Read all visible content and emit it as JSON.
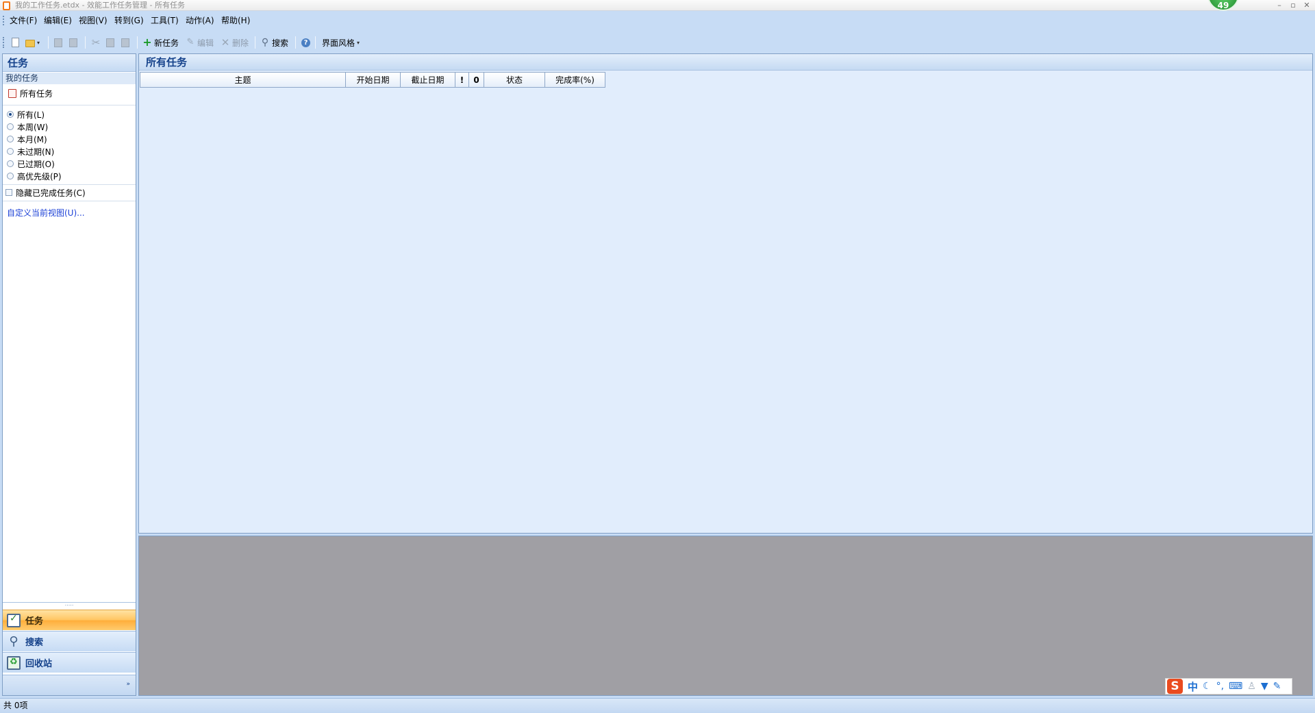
{
  "window": {
    "title": "我的工作任务.etdx - 效能工作任务管理 - 所有任务",
    "badge": "49",
    "controls": {
      "minimize": "–",
      "restore": "▫",
      "close": "✕"
    }
  },
  "menu": {
    "items": [
      "文件(F)",
      "编辑(E)",
      "视图(V)",
      "转到(G)",
      "工具(T)",
      "动作(A)",
      "帮助(H)"
    ]
  },
  "toolbar": {
    "new_task": "新任务",
    "edit": "编辑",
    "delete": "删除",
    "search": "搜索",
    "theme": "界面风格",
    "caret": "▾"
  },
  "left_pane": {
    "header": "任务",
    "group_label": "我的任务",
    "folder": "所有任务",
    "filters": [
      {
        "label": "所有(L)",
        "checked": true
      },
      {
        "label": "本周(W)",
        "checked": false
      },
      {
        "label": "本月(M)",
        "checked": false
      },
      {
        "label": "未过期(N)",
        "checked": false
      },
      {
        "label": "已过期(O)",
        "checked": false
      },
      {
        "label": "高优先级(P)",
        "checked": false
      }
    ],
    "hide_completed": "隐藏已完成任务(C)",
    "customize_view": "自定义当前视图(U)...",
    "splitter": ".....",
    "nav": {
      "tasks": "任务",
      "search": "搜索",
      "recycle": "回收站",
      "more": "»"
    }
  },
  "main": {
    "title": "所有任务",
    "columns": [
      "主题",
      "开始日期",
      "截止日期",
      "!",
      "0",
      "状态",
      "完成率(%)"
    ]
  },
  "ime": {
    "logo": "S",
    "lang": "中",
    "icons": [
      "moon-icon",
      "punctuation-icon",
      "keyboard-icon",
      "user-icon",
      "skin-icon",
      "settings-icon"
    ]
  },
  "status": {
    "count": "共 0项"
  },
  "colors": {
    "accent_active": "#ffc561",
    "header_text": "#15428b",
    "preview_bg": "#a09fa4"
  }
}
